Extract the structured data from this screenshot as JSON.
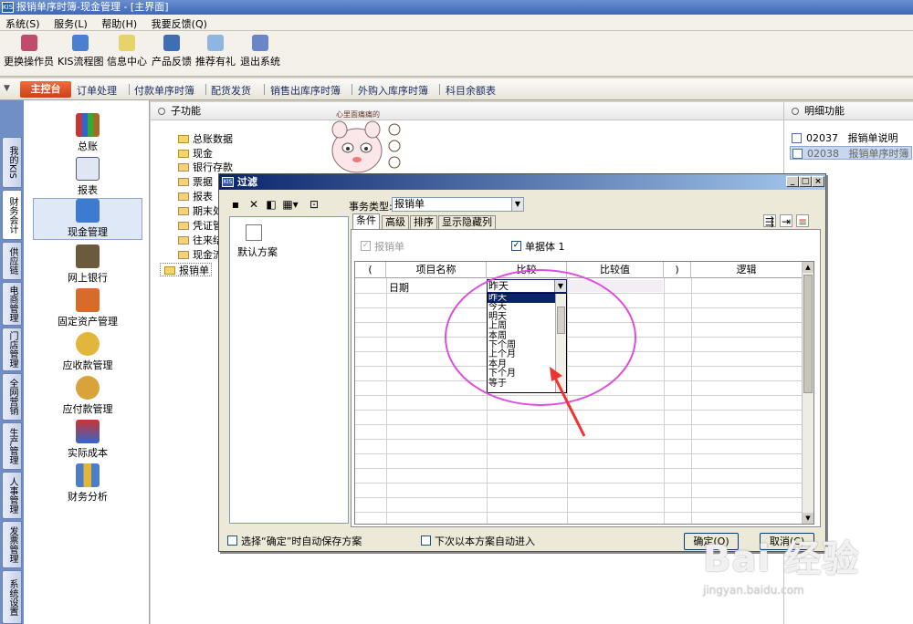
{
  "window": {
    "title": "报销单序时簿-现金管理 - [主界面]",
    "logo": "KIS"
  },
  "menu": [
    {
      "label": "系统(S)"
    },
    {
      "label": "服务(L)"
    },
    {
      "label": "帮助(H)"
    },
    {
      "label": "我要反馈(Q)"
    }
  ],
  "toolbar": [
    {
      "label": "更换操作员",
      "icon": "switch-user-icon"
    },
    {
      "label": "KIS流程图",
      "icon": "flowchart-icon"
    },
    {
      "label": "信息中心",
      "icon": "message-icon"
    },
    {
      "label": "产品反馈",
      "icon": "feedback-icon"
    },
    {
      "label": "推荐有礼",
      "icon": "gift-icon"
    },
    {
      "label": "退出系统",
      "icon": "exit-icon"
    }
  ],
  "tabstrip": {
    "main": "主控台",
    "tabs": [
      "订单处理",
      "付款单序时簿",
      "配货发货",
      "销售出库序时簿",
      "外购入库序时簿",
      "科目余额表"
    ]
  },
  "vtabs": [
    "我的KIS",
    "财务会计",
    "供应链",
    "电商管理",
    "门店管理",
    "全网营销",
    "生产管理",
    "人事管理",
    "发票管理",
    "系统设置"
  ],
  "modules": [
    "总账",
    "报表",
    "现金管理",
    "网上银行",
    "固定资产管理",
    "应收款管理",
    "应付款管理",
    "实际成本",
    "财务分析"
  ],
  "subfunc": {
    "header": "子功能",
    "items": [
      "总账数据",
      "现金",
      "银行存款",
      "票据",
      "报表",
      "期末处",
      "凭证管",
      "往来结",
      "现金流",
      "报销单"
    ]
  },
  "detail": {
    "header": "明细功能",
    "items": [
      {
        "code": "02037",
        "name": "报销单说明"
      },
      {
        "code": "02038",
        "name": "报销单序时簿"
      }
    ]
  },
  "sticker": {
    "text": "心里面痛痛的"
  },
  "dialog": {
    "title": "过滤",
    "logo": "KIS",
    "scheme": "默认方案",
    "biztype_label": "事务类型:",
    "biztype_value": "报销单",
    "tabs": [
      "条件",
      "高级",
      "排序",
      "显示隐藏列"
    ],
    "chk_baoxiao": "报销单",
    "chk_danju": "单据体 1",
    "grid_headers": [
      "(",
      "项目名称",
      "比较",
      "比较值",
      ")",
      "逻辑"
    ],
    "row1_field": "日期",
    "compare_selected": "昨天",
    "dropdown_options": [
      "昨天",
      "今天",
      "明天",
      "上周",
      "本周",
      "下个周",
      "上个月",
      "本月",
      "下个月",
      "等于"
    ],
    "footer_save": "选择“确定”时自动保存方案",
    "footer_auto": "下次以本方案自动进入",
    "ok": "确定(O)",
    "cancel": "取消(C)"
  },
  "watermark": {
    "brand": "Bai 经验",
    "url": "jingyan.baidu.com"
  }
}
